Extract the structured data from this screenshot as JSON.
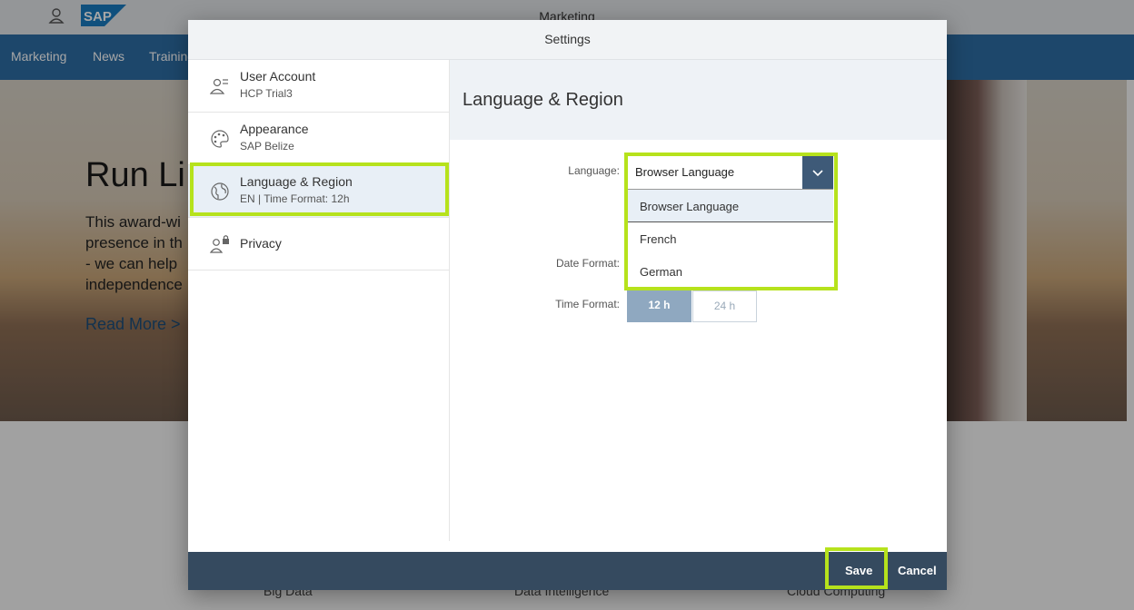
{
  "shell": {
    "title": "Marketing",
    "logo_text": "SAP"
  },
  "nav": {
    "items": [
      "Marketing",
      "News",
      "Training"
    ]
  },
  "hero": {
    "title": "Run Li",
    "lines": [
      "This award-wi",
      "presence in th",
      "- we can help",
      "independence"
    ],
    "link": "Read More >"
  },
  "categories": [
    "Big Data",
    "Data Intelligence",
    "Cloud Computing"
  ],
  "dialog": {
    "title": "Settings",
    "sections": [
      {
        "title": "User Account",
        "subtitle": "HCP Trial3",
        "icon": "user-account-icon"
      },
      {
        "title": "Appearance",
        "subtitle": "SAP Belize",
        "icon": "palette-icon"
      },
      {
        "title": "Language & Region",
        "subtitle": "EN | Time Format: 12h",
        "icon": "globe-icon",
        "selected": true
      },
      {
        "title": "Privacy",
        "subtitle": "",
        "icon": "user-lock-icon"
      }
    ],
    "detail": {
      "title": "Language & Region",
      "language_label": "Language:",
      "language_value": "Browser Language",
      "language_options": [
        "Browser Language",
        "French",
        "German"
      ],
      "date_format_label": "Date Format:",
      "time_format_label": "Time Format:",
      "time_options": [
        "12 h",
        "24 h"
      ],
      "time_selected": "12 h"
    },
    "footer": {
      "save": "Save",
      "cancel": "Cancel"
    }
  },
  "colors": {
    "highlight": "#b6e21c",
    "nav_bg": "#2d6da5",
    "footer_bg": "#354a5f",
    "select_btn": "#3e5a78"
  }
}
